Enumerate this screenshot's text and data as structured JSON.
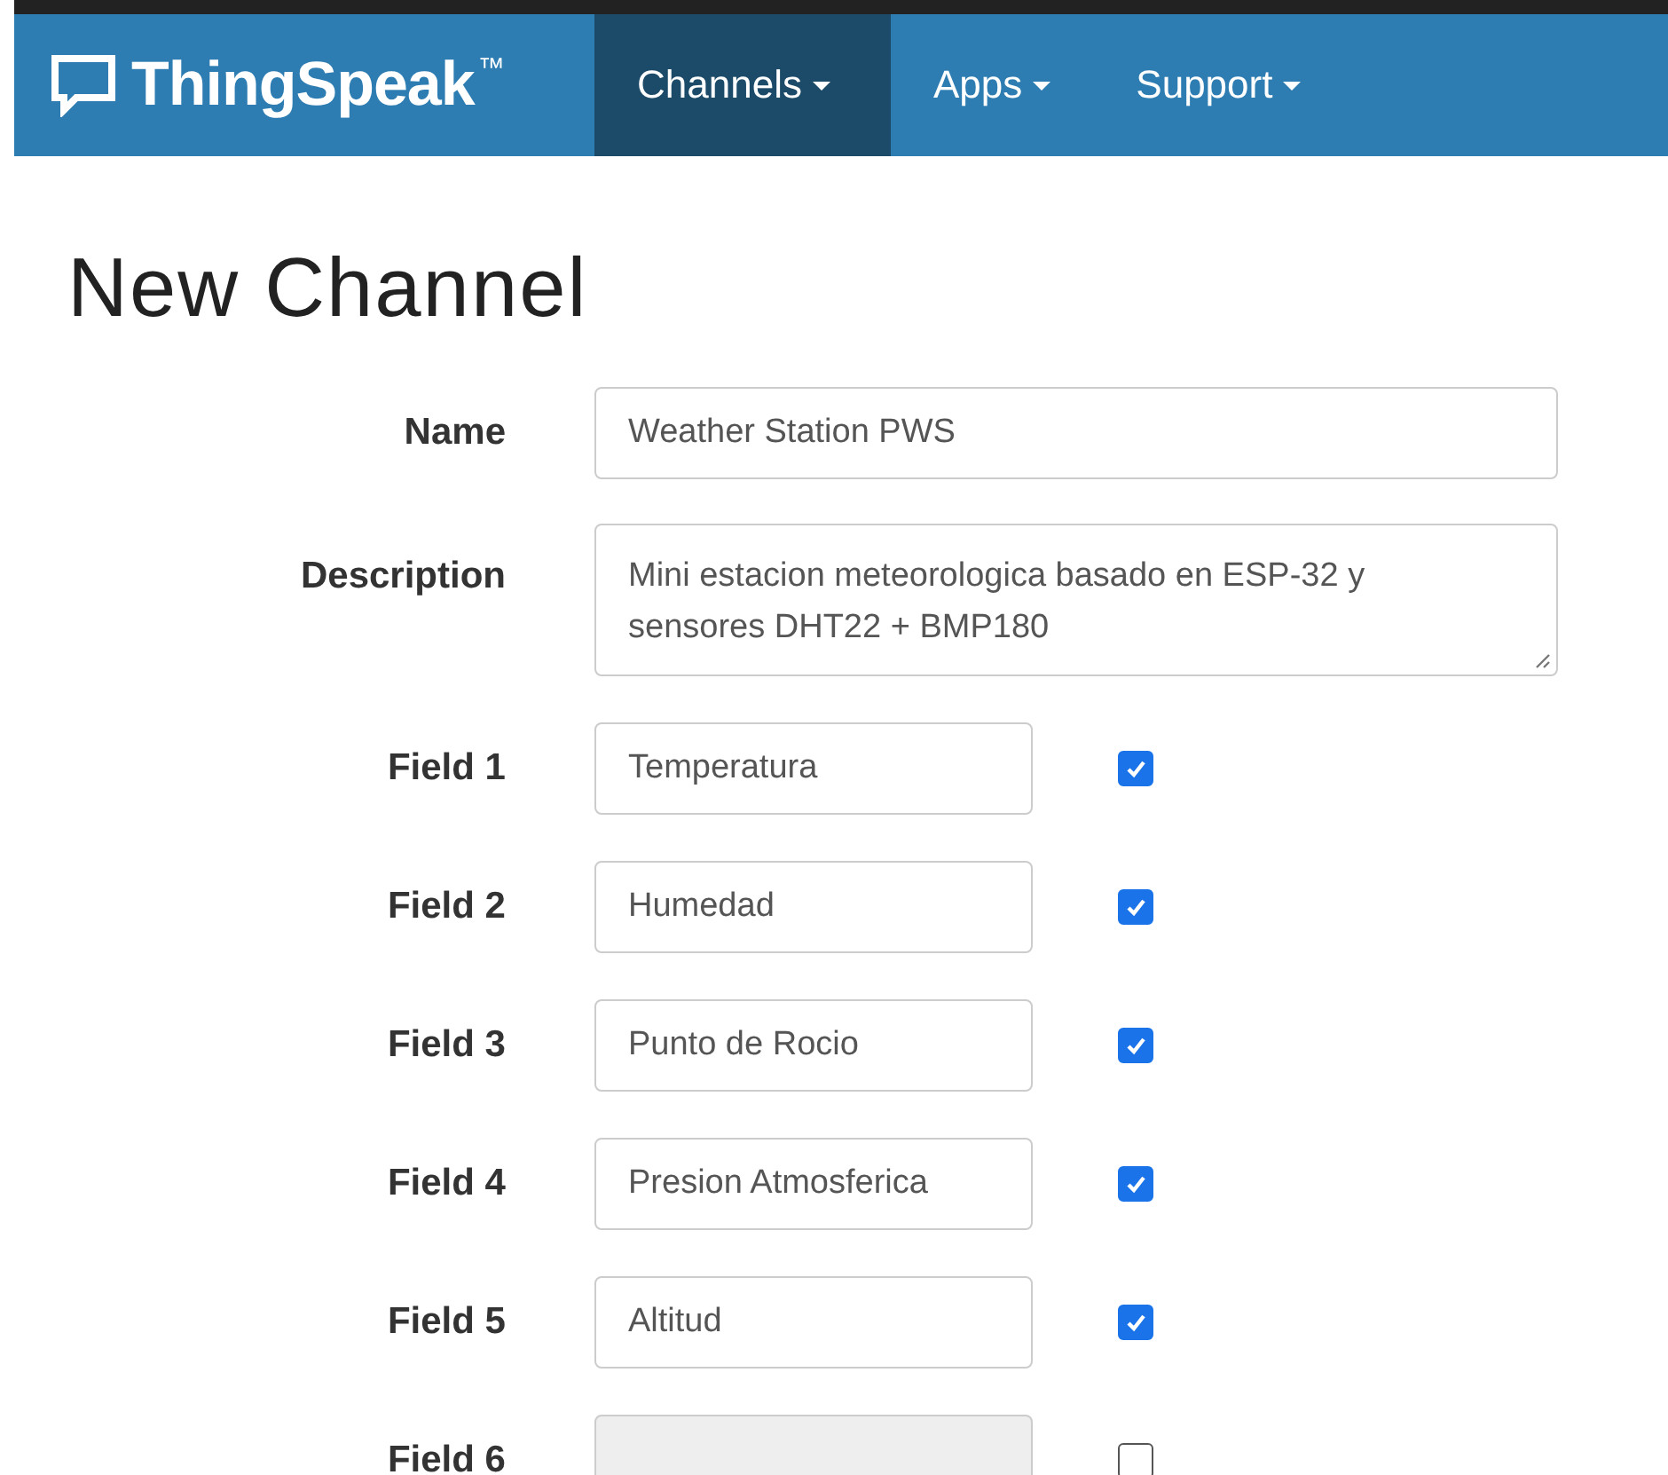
{
  "navbar": {
    "brand": "ThingSpeak",
    "trademark": "™",
    "menus": [
      {
        "label": "Channels",
        "selected": true
      },
      {
        "label": "Apps",
        "selected": false
      },
      {
        "label": "Support",
        "selected": false
      }
    ]
  },
  "title": "New Channel",
  "name": {
    "label": "Name",
    "value": "Weather Station PWS"
  },
  "description": {
    "label": "Description",
    "value": "Mini estacion meteorologica basado en ESP-32 y sensores DHT22 + BMP180"
  },
  "fields": [
    {
      "label": "Field 1",
      "value": "Temperatura",
      "checked": true
    },
    {
      "label": "Field 2",
      "value": "Humedad",
      "checked": true
    },
    {
      "label": "Field 3",
      "value": "Punto de Rocio",
      "checked": true
    },
    {
      "label": "Field 4",
      "value": "Presion Atmosferica",
      "checked": true
    },
    {
      "label": "Field 5",
      "value": "Altitud",
      "checked": true
    },
    {
      "label": "Field 6",
      "checked": false
    }
  ]
}
